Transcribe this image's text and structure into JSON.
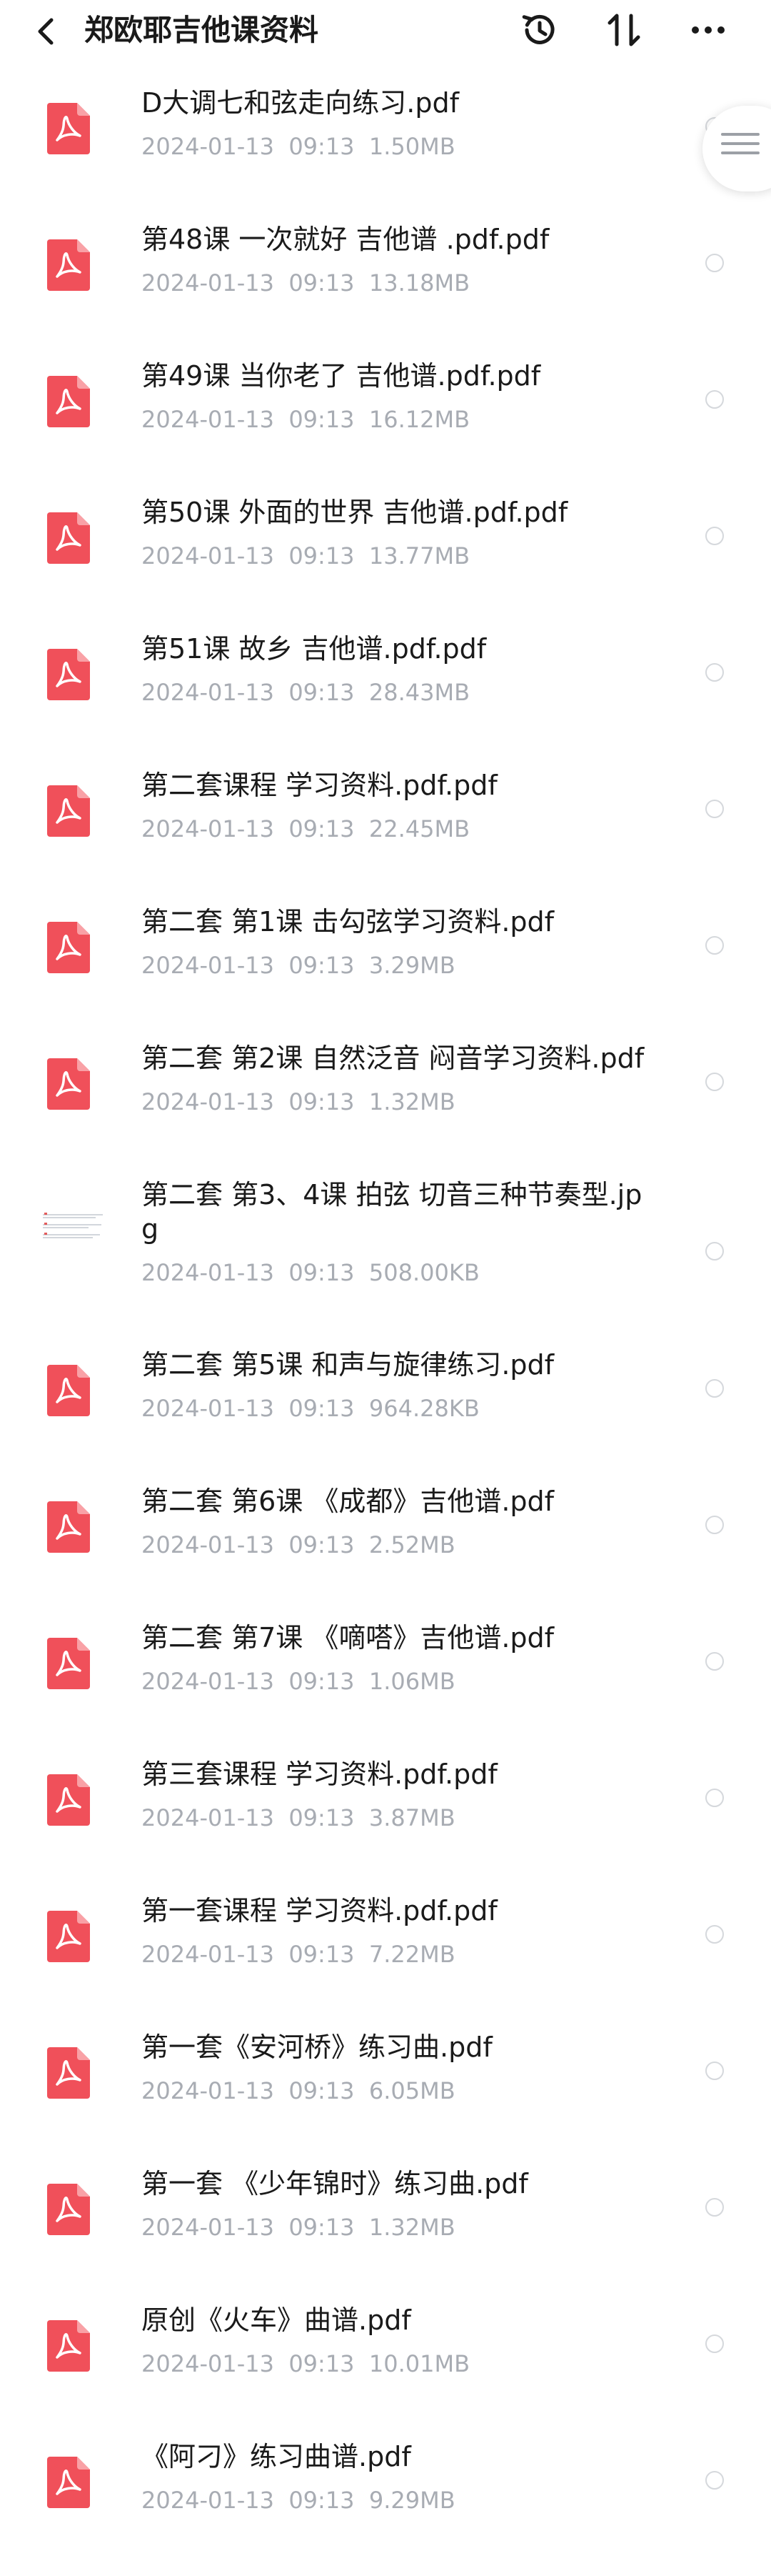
{
  "header": {
    "title": "郑欧耶吉他课资料",
    "icons": [
      "back-icon",
      "history-icon",
      "sort-icon",
      "more-icon"
    ]
  },
  "colors": {
    "pdf_icon": "#f0505a",
    "meta_text": "#a8acb3",
    "radio_border": "#d5d8dc"
  },
  "files": [
    {
      "name": "D大调七和弦走向练习.pdf",
      "date": "2024-01-13",
      "time": "09:13",
      "size": "1.50MB",
      "type": "pdf"
    },
    {
      "name": "第48课 一次就好 吉他谱 .pdf.pdf",
      "date": "2024-01-13",
      "time": "09:13",
      "size": "13.18MB",
      "type": "pdf"
    },
    {
      "name": "第49课 当你老了 吉他谱.pdf.pdf",
      "date": "2024-01-13",
      "time": "09:13",
      "size": "16.12MB",
      "type": "pdf"
    },
    {
      "name": "第50课 外面的世界 吉他谱.pdf.pdf",
      "date": "2024-01-13",
      "time": "09:13",
      "size": "13.77MB",
      "type": "pdf"
    },
    {
      "name": "第51课 故乡 吉他谱.pdf.pdf",
      "date": "2024-01-13",
      "time": "09:13",
      "size": "28.43MB",
      "type": "pdf"
    },
    {
      "name": "第二套课程 学习资料.pdf.pdf",
      "date": "2024-01-13",
      "time": "09:13",
      "size": "22.45MB",
      "type": "pdf"
    },
    {
      "name": "第二套 第1课 击勾弦学习资料.pdf",
      "date": "2024-01-13",
      "time": "09:13",
      "size": "3.29MB",
      "type": "pdf"
    },
    {
      "name": "第二套 第2课 自然泛音 闷音学习资料.pdf",
      "date": "2024-01-13",
      "time": "09:13",
      "size": "1.32MB",
      "type": "pdf"
    },
    {
      "name": "第二套 第3、4课 拍弦 切音三种节奏型.jpg",
      "date": "2024-01-13",
      "time": "09:13",
      "size": "508.00KB",
      "type": "jpg"
    },
    {
      "name": "第二套 第5课 和声与旋律练习.pdf",
      "date": "2024-01-13",
      "time": "09:13",
      "size": "964.28KB",
      "type": "pdf"
    },
    {
      "name": "第二套 第6课 《成都》吉他谱.pdf",
      "date": "2024-01-13",
      "time": "09:13",
      "size": "2.52MB",
      "type": "pdf"
    },
    {
      "name": "第二套 第7课 《嘀嗒》吉他谱.pdf",
      "date": "2024-01-13",
      "time": "09:13",
      "size": "1.06MB",
      "type": "pdf"
    },
    {
      "name": "第三套课程 学习资料.pdf.pdf",
      "date": "2024-01-13",
      "time": "09:13",
      "size": "3.87MB",
      "type": "pdf"
    },
    {
      "name": "第一套课程 学习资料.pdf.pdf",
      "date": "2024-01-13",
      "time": "09:13",
      "size": "7.22MB",
      "type": "pdf"
    },
    {
      "name": "第一套《安河桥》练习曲.pdf",
      "date": "2024-01-13",
      "time": "09:13",
      "size": "6.05MB",
      "type": "pdf"
    },
    {
      "name": "第一套 《少年锦时》练习曲.pdf",
      "date": "2024-01-13",
      "time": "09:13",
      "size": "1.32MB",
      "type": "pdf"
    },
    {
      "name": "原创《火车》曲谱.pdf",
      "date": "2024-01-13",
      "time": "09:13",
      "size": "10.01MB",
      "type": "pdf"
    },
    {
      "name": "《阿刁》练习曲谱.pdf",
      "date": "2024-01-13",
      "time": "09:13",
      "size": "9.29MB",
      "type": "pdf"
    }
  ]
}
